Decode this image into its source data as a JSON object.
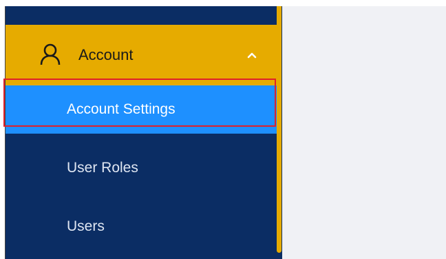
{
  "sidebar": {
    "account_menu": {
      "label": "Account",
      "icon": "user-icon",
      "expanded": true,
      "chevron_icon": "chevron-up-icon"
    },
    "items": [
      {
        "label": "Account Settings",
        "active": true
      },
      {
        "label": "User Roles",
        "active": false
      },
      {
        "label": "Users",
        "active": false
      }
    ]
  },
  "colors": {
    "sidebar_bg": "#0b2d64",
    "accent": "#e6ab00",
    "active_item": "#1e90ff",
    "highlight_outline": "#e0202a",
    "content_bg": "#f0f1f5"
  }
}
